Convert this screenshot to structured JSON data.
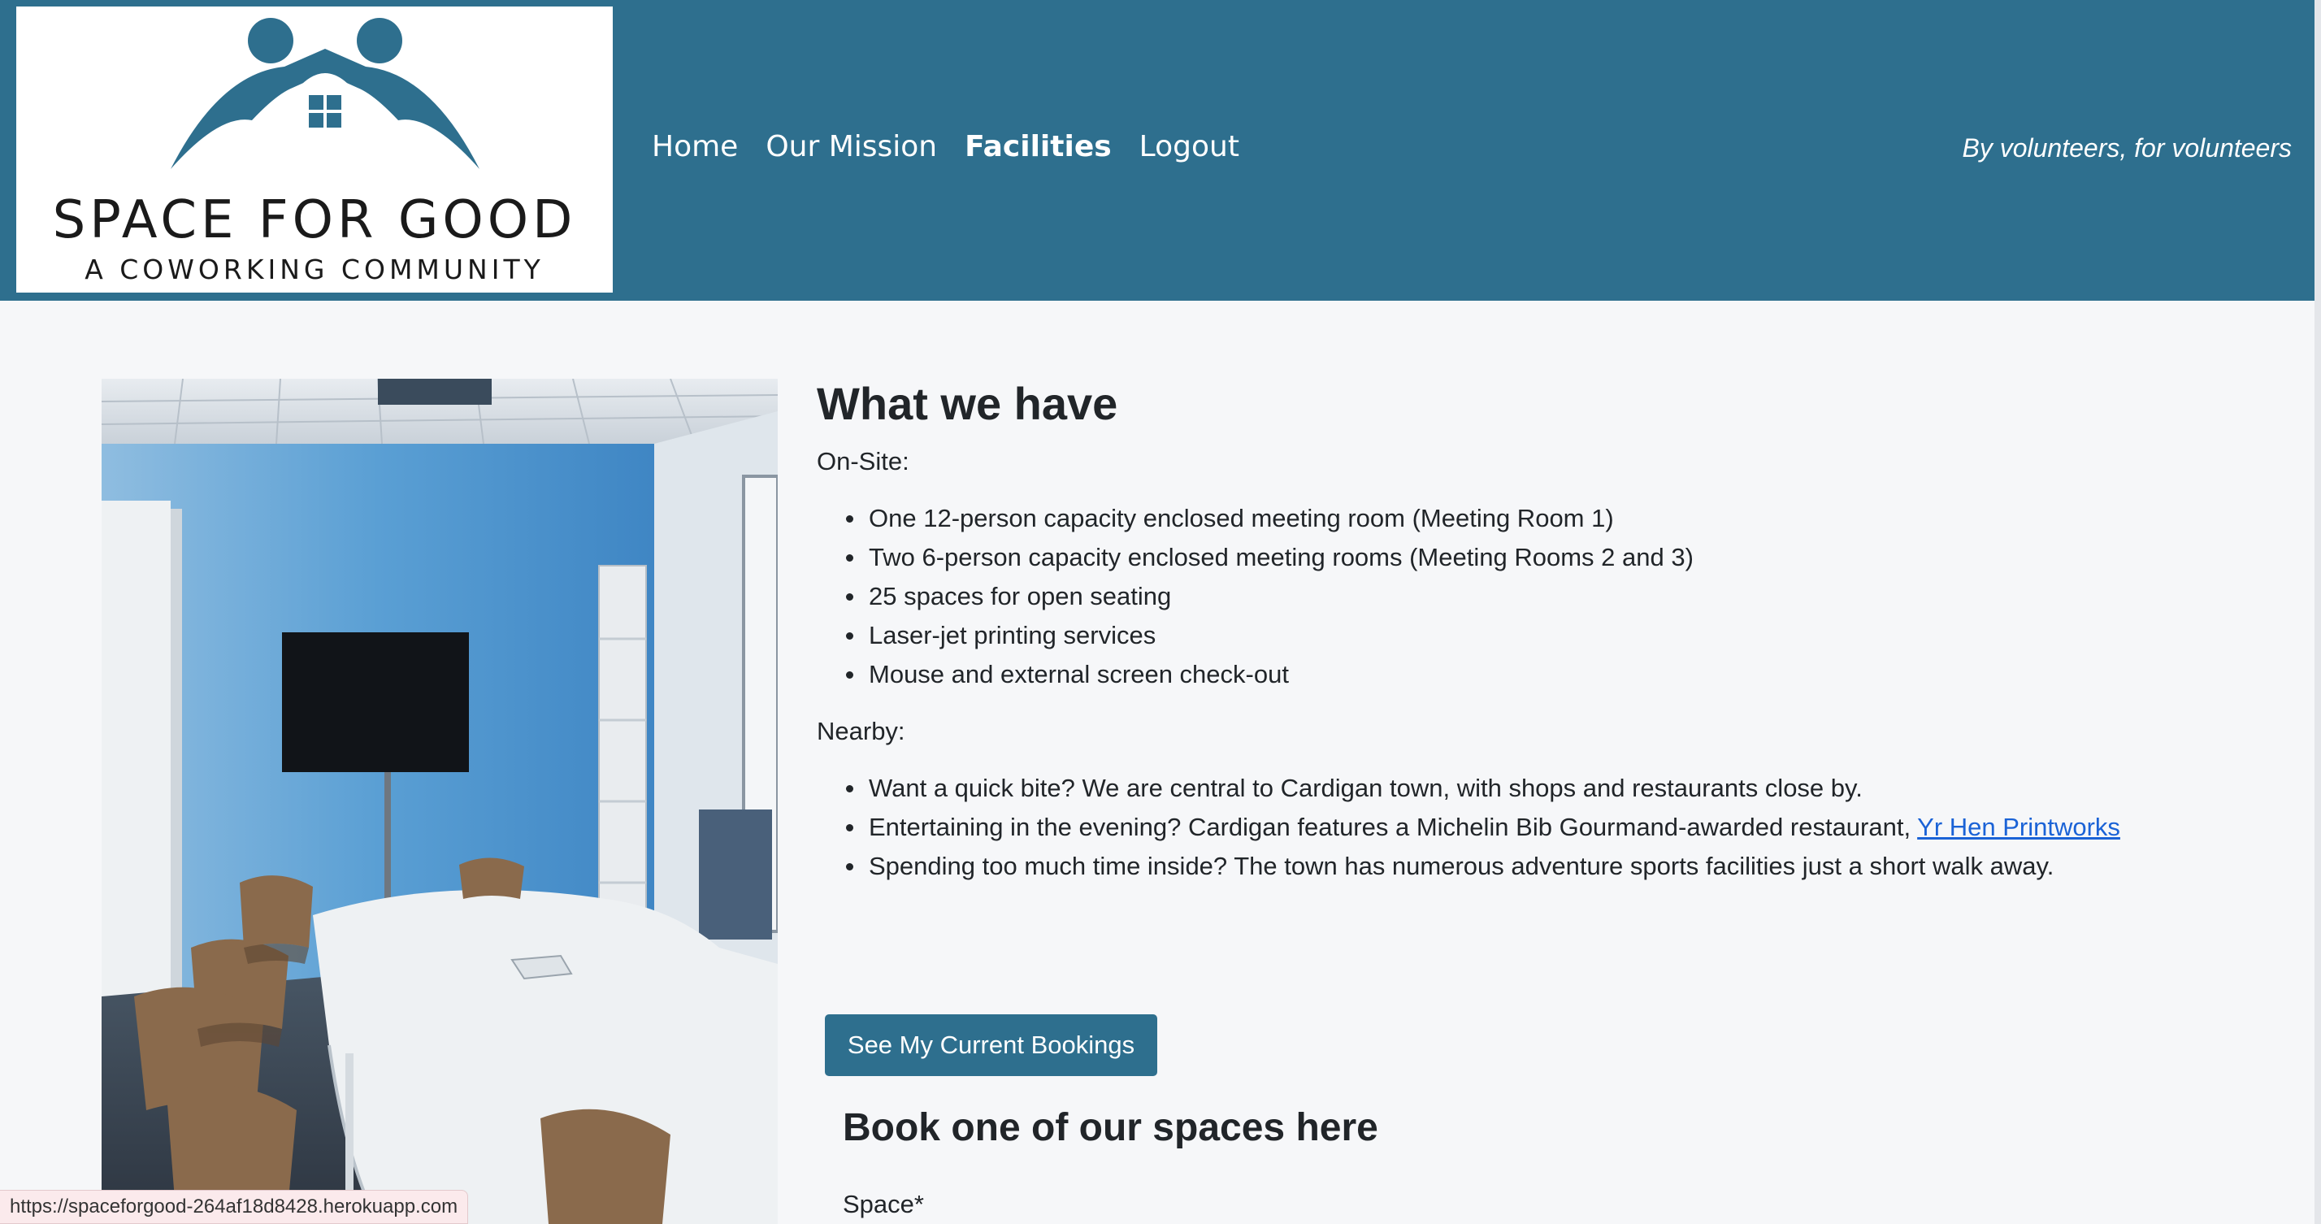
{
  "header": {
    "logo": {
      "title": "SPACE FOR GOOD",
      "subtitle": "A COWORKING COMMUNITY",
      "brand_color": "#2e6f8e"
    },
    "nav": [
      {
        "label": "Home",
        "active": false
      },
      {
        "label": "Our Mission",
        "active": false
      },
      {
        "label": "Facilities",
        "active": true
      },
      {
        "label": "Logout",
        "active": false
      }
    ],
    "tagline": "By volunteers, for volunteers"
  },
  "main": {
    "title": "What we have",
    "onsite_label": "On-Site:",
    "onsite_items": [
      "One 12-person capacity enclosed meeting room (Meeting Room 1)",
      "Two 6-person capacity enclosed meeting rooms (Meeting Rooms 2 and 3)",
      "25 spaces for open seating",
      "Laser-jet printing services",
      "Mouse and external screen check-out"
    ],
    "nearby_label": "Nearby:",
    "nearby_items": [
      "Want a quick bite? We are central to Cardigan town, with shops and restaurants close by.",
      "Entertaining in the evening? Cardigan features a Michelin Bib Gourmand-awarded restaurant, ",
      "Spending too much time inside? The town has numerous adventure sports facilities just a short walk away."
    ],
    "nearby_link_text": "Yr Hen Printworks",
    "bookings_button": "See My Current Bookings",
    "book_title": "Book one of our spaces here",
    "space_label": "Space*"
  },
  "status_bar": {
    "url": "https://spaceforgood-264af18d8428.herokuapp.com"
  },
  "colors": {
    "navbar": "#2e6f8e",
    "link": "#1a62d6",
    "page_bg": "#f6f7f9"
  }
}
